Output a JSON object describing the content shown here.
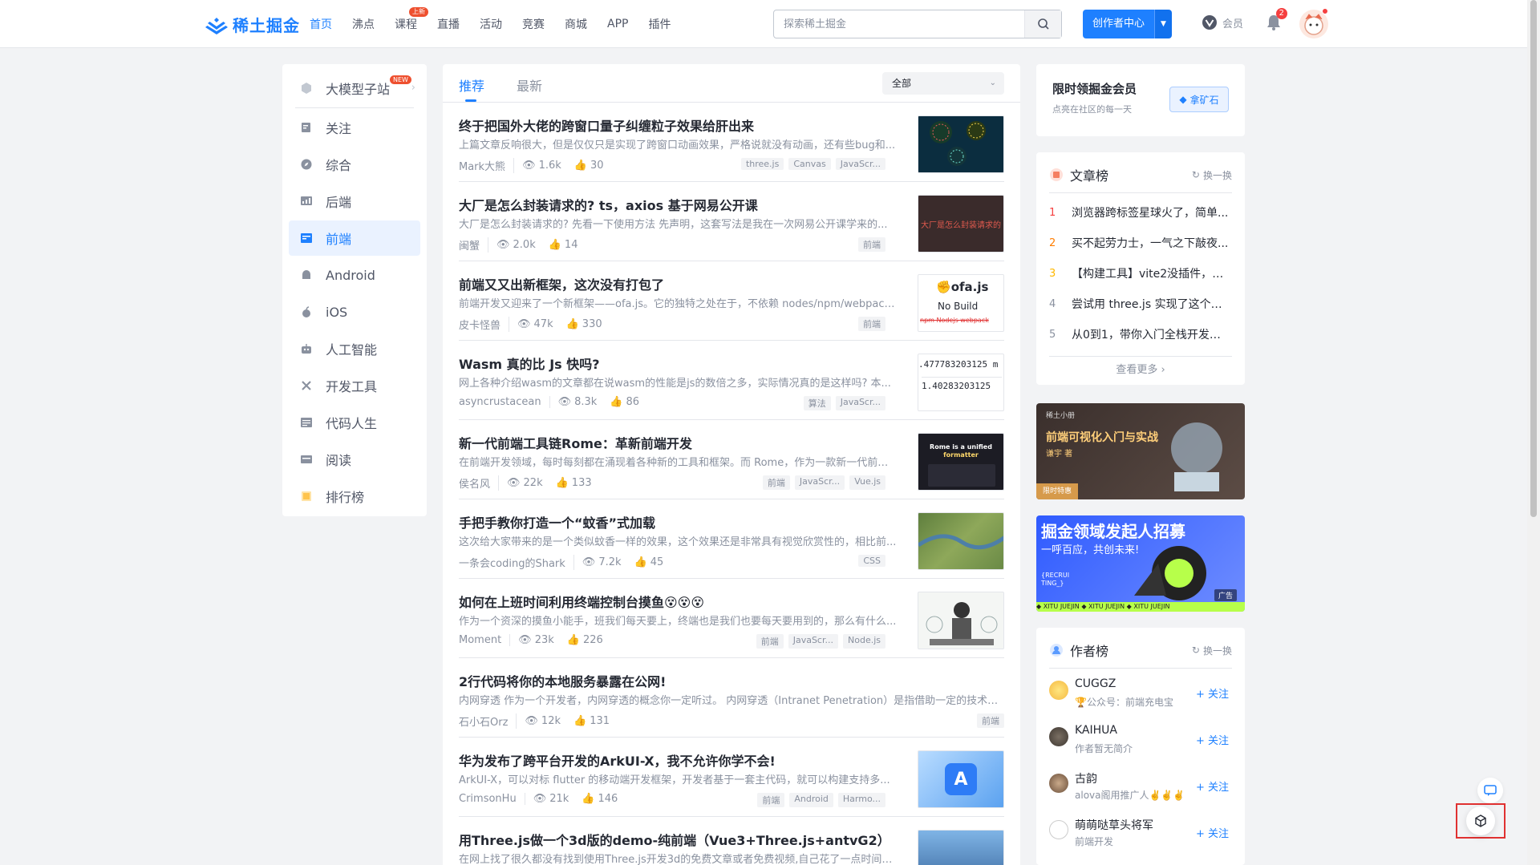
{
  "header": {
    "logo_text": "稀土掘金",
    "nav": [
      {
        "label": "首页",
        "active": true
      },
      {
        "label": "沸点"
      },
      {
        "label": "课程",
        "badge": "上新"
      },
      {
        "label": "直播"
      },
      {
        "label": "活动"
      },
      {
        "label": "竞赛"
      },
      {
        "label": "商城"
      },
      {
        "label": "APP"
      },
      {
        "label": "插件"
      }
    ],
    "search_placeholder": "探索稀土掘金",
    "creator_label": "创作者中心",
    "vip_label": "会员",
    "notification_count": "2"
  },
  "sidebar": {
    "items": [
      {
        "label": "大模型子站",
        "badge": "NEW",
        "icon": "cube-icon"
      },
      {
        "label": "关注",
        "icon": "follow-icon"
      },
      {
        "label": "综合",
        "icon": "compass-icon"
      },
      {
        "label": "后端",
        "icon": "backend-icon"
      },
      {
        "label": "前端",
        "icon": "frontend-icon",
        "active": true
      },
      {
        "label": "Android",
        "icon": "android-icon"
      },
      {
        "label": "iOS",
        "icon": "apple-icon"
      },
      {
        "label": "人工智能",
        "icon": "robot-icon"
      },
      {
        "label": "开发工具",
        "icon": "tools-icon"
      },
      {
        "label": "代码人生",
        "icon": "code-icon"
      },
      {
        "label": "阅读",
        "icon": "book-icon"
      },
      {
        "label": "排行榜",
        "icon": "ranking-icon"
      }
    ]
  },
  "feed": {
    "tabs": [
      {
        "label": "推荐",
        "active": true
      },
      {
        "label": "最新"
      }
    ],
    "filter_label": "全部",
    "articles": [
      {
        "title": "终于把国外大佬的跨窗口量子纠缠粒子效果给肝出来",
        "brief": "上篇文章反响很大，但是仅仅只是实现了跨窗口动画效果，严格说就没有动画，还有些bug和...",
        "author": "Mark大熊",
        "views": "1.6k",
        "likes": "30",
        "tags": [
          "three.js",
          "Canvas",
          "JavaScr..."
        ]
      },
      {
        "title": "大厂是怎么封装请求的? ts，axios 基于网易公开课",
        "brief": "大厂是怎么封装请求的? 先看一下使用方法 先声明，这套写法是我在一次网易公开课学来的...",
        "author": "闽蟹",
        "views": "2.0k",
        "likes": "14",
        "tags": [
          "前端"
        ],
        "thumb_text": "大厂是怎么封装请求的"
      },
      {
        "title": "前端又又出新框架，这次没有打包了",
        "brief": "前端开发又迎来了一个新框架——ofa.js。它的独特之处在于，不依赖 nodes/npm/webpack...",
        "author": "皮卡怪兽",
        "views": "47k",
        "likes": "330",
        "tags": [
          "前端"
        ],
        "thumb_text": {
          "brand": "ofa.js",
          "sub": "No Build",
          "strike": "npm  Nodejs  webpack"
        }
      },
      {
        "title": "Wasm 真的比 Js 快吗?",
        "brief": "网上各种介绍wasm的文章都在说wasm的性能是js的数倍之多，实际情况真的是这样吗? 本...",
        "author": "asyncrustacean",
        "views": "8.3k",
        "likes": "86",
        "tags": [
          "算法",
          "JavaScr..."
        ],
        "thumb_text": {
          "line1": ".477783203125 m",
          "line2": "1.40283203125"
        }
      },
      {
        "title": "新一代前端工具链Rome：革新前端开发",
        "brief": "在前端开发领域，每时每刻都在涌现着各种新的工具和框架。而 Rome，作为一款新一代前端...",
        "author": "侯名风",
        "views": "22k",
        "likes": "133",
        "tags": [
          "前端",
          "JavaScr...",
          "Vue.js"
        ],
        "thumb_text": {
          "line1": "Rome is a unified",
          "line2": "formatter"
        }
      },
      {
        "title": "手把手教你打造一个“蚊香”式加载",
        "brief": "这次给大家带来的是一个类似蚊香一样的效果，这个效果还是非常具有视觉欣赏性的，相比前...",
        "author": "一条会coding的Shark",
        "views": "7.2k",
        "likes": "45",
        "tags": [
          "CSS"
        ]
      },
      {
        "title": "如何在上班时间利用终端控制台摸鱼😵😵😵",
        "brief": "作为一个资深的摸鱼小能手，班我们每天要上，终端也是我们也要每天要用到的，那么有什么...",
        "author": "Moment",
        "views": "23k",
        "likes": "226",
        "tags": [
          "前端",
          "JavaScr...",
          "Node.js"
        ]
      },
      {
        "title": "2行代码将你的本地服务暴露在公网!",
        "brief": "内网穿透 作为一个开发者，内网穿透的概念你一定听过。 内网穿透（Intranet Penetration）是指借助一定的技术手...",
        "author": "石小石Orz",
        "views": "12k",
        "likes": "131",
        "tags": [
          "前端"
        ]
      },
      {
        "title": "华为发布了跨平台开发的ArkUI-X，我不允许你学不会!",
        "brief": "ArkUI-X，可以对标 flutter 的移动端开发框架，开发者基于一套主代码，就可以构建支持多...",
        "author": "CrimsonHu",
        "views": "21k",
        "likes": "146",
        "tags": [
          "前端",
          "Android",
          "Harmo..."
        ]
      },
      {
        "title": "用Three.js做一个3d版的demo-纯前端（Vue3+Three.js+antvG2）",
        "brief": "在网上找了很久都没有找到使用Three.js开发3d的免费文章或者免费视频,自己花了一点时间做...",
        "author": "",
        "views": "",
        "likes": "",
        "tags": []
      }
    ]
  },
  "member_card": {
    "title": "限时领掘金会员",
    "subtitle": "点亮在社区的每一天",
    "button": "拿矿石"
  },
  "article_rank": {
    "title": "文章榜",
    "refresh": "换一换",
    "items": [
      "浏览器跨标签星球火了，简单...",
      "买不起劳力士，一气之下敲夜...",
      "【构建工具】vite2没插件，vit...",
      "尝试用 three.js 实现了这个跨...",
      "从0到1，带你入门全栈开发，..."
    ],
    "numbers": [
      "1",
      "2",
      "3",
      "4",
      "5"
    ],
    "see_more": "查看更多 ›"
  },
  "banner1": {
    "corner": "稀土小册",
    "title": "前端可视化入门与实战",
    "author": "谦宇 著",
    "tag": "限时特惠"
  },
  "banner2": {
    "title": "掘金领域发起人招募",
    "subtitle": "一呼百应，共创未来!",
    "recruit": "{RECRUI TING_}",
    "ad": "广告",
    "footer": "◆ XITU JUEJIN ◆ XITU JUEJIN ◆ XITU JUEJIN"
  },
  "author_rank": {
    "title": "作者榜",
    "refresh": "换一换",
    "items": [
      {
        "name": "CUGGZ",
        "desc": "🏆公众号：前端充电宝",
        "follow": "+ 关注"
      },
      {
        "name": "KAIHUA",
        "desc": "作者暂无简介",
        "follow": "+ 关注"
      },
      {
        "name": "古韵",
        "desc": "alova阁用推广人✌️✌️✌️",
        "follow": "+ 关注"
      },
      {
        "name": "萌萌哒草头将军",
        "desc": "前端开发",
        "follow": "+ 关注"
      }
    ]
  },
  "colors": {
    "brand": "#1e80ff",
    "red": "#f53f3f"
  }
}
